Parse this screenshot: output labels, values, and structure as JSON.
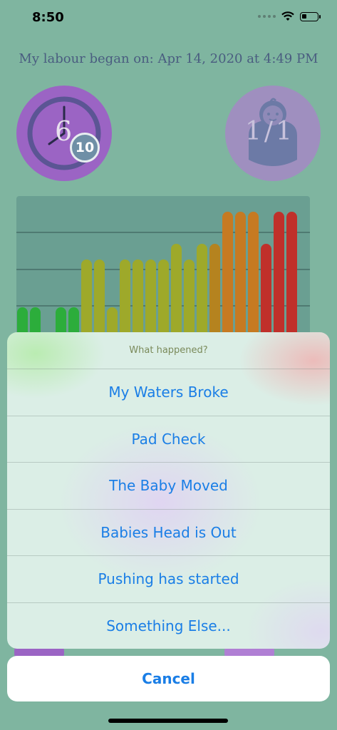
{
  "status_bar": {
    "time": "8:50"
  },
  "labour_start_text": "My labour began on: Apr 14, 2020 at 4:49 PM",
  "timer": {
    "main_number": "6",
    "badge_number": "10",
    "icon": "clock-icon"
  },
  "baby": {
    "count": "1/1",
    "icon": "baby-icon"
  },
  "chart_data": {
    "type": "bar",
    "categories": [],
    "values": [
      2,
      2,
      0,
      2,
      2,
      5,
      5,
      2,
      5,
      5,
      5,
      5,
      6,
      5,
      6,
      6,
      8,
      8,
      8,
      6,
      8,
      8
    ],
    "ylim": [
      0,
      9
    ],
    "grid": true,
    "colors": [
      "#2cad3b",
      "#2cad3b",
      "#2cad3b",
      "#2cad3b",
      "#2cad3b",
      "#9ea92a",
      "#9ea92a",
      "#9ea92a",
      "#9ea92a",
      "#9ea92a",
      "#9ea92a",
      "#9ea92a",
      "#9ea92a",
      "#9ea92a",
      "#9ea92a",
      "#b5831f",
      "#c67a22",
      "#c67a22",
      "#c67a22",
      "#c0302a",
      "#c0302a",
      "#c0302a"
    ]
  },
  "action_sheet": {
    "title": "What happened?",
    "items": [
      "My Waters Broke",
      "Pad Check",
      "The Baby Moved",
      "Babies Head is Out",
      "Pushing has started",
      "Something Else..."
    ],
    "cancel_label": "Cancel"
  },
  "colors": {
    "background": "#7fb5a0",
    "accent_blue": "#1a7ee6",
    "timer_purple": "#9b64c4",
    "baby_purple": "#9f8fbf"
  }
}
